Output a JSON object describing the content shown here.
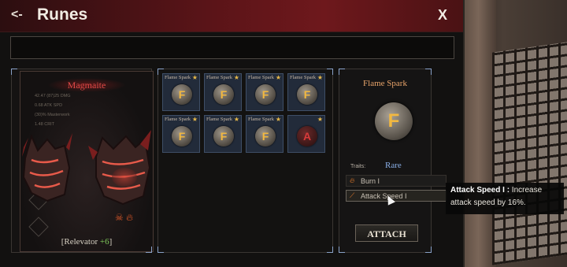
{
  "window": {
    "back_label": "<-",
    "title": "Runes",
    "close_label": "X"
  },
  "search": {
    "value": ""
  },
  "equipment": {
    "name": "Magmaite",
    "stats": [
      "42.47 (87)25 DMG",
      "0.68 ATK SPD",
      "(30)% Masterwork",
      "1.48 CRIT"
    ],
    "relevator_label": "Relevator",
    "relevator_bonus": "+6"
  },
  "runes": [
    {
      "name": "Flame Spark",
      "symbol": "F",
      "color": "gold",
      "starred": true
    },
    {
      "name": "Flame Spark",
      "symbol": "F",
      "color": "gold",
      "starred": true
    },
    {
      "name": "Flame Spark",
      "symbol": "F",
      "color": "gold",
      "starred": true
    },
    {
      "name": "Flame Spark",
      "symbol": "F",
      "color": "gold",
      "starred": true
    },
    {
      "name": "Flame Spark",
      "symbol": "F",
      "color": "gold",
      "starred": true
    },
    {
      "name": "Flame Spark",
      "symbol": "F",
      "color": "gold",
      "starred": true
    },
    {
      "name": "Flame Spark",
      "symbol": "F",
      "color": "gold",
      "starred": true
    },
    {
      "name": "",
      "symbol": "A",
      "color": "red",
      "starred": true
    }
  ],
  "detail": {
    "name": "Flame Spark",
    "symbol": "F",
    "traits_label": "Traits:",
    "rarity": "Rare",
    "traits": [
      {
        "label": "Burn I",
        "icon": "flame-icon"
      },
      {
        "label": "Attack Speed I",
        "icon": "blade-icon"
      }
    ],
    "attach_label": "ATTACH"
  },
  "tooltip": {
    "title": "Attack Speed I :",
    "text": " Increase attack speed by 16%."
  },
  "colors": {
    "title_bar": "#5a1418",
    "rare": "#8ab0e8",
    "accent": "#f2b840",
    "item_name": "#e04a48"
  }
}
